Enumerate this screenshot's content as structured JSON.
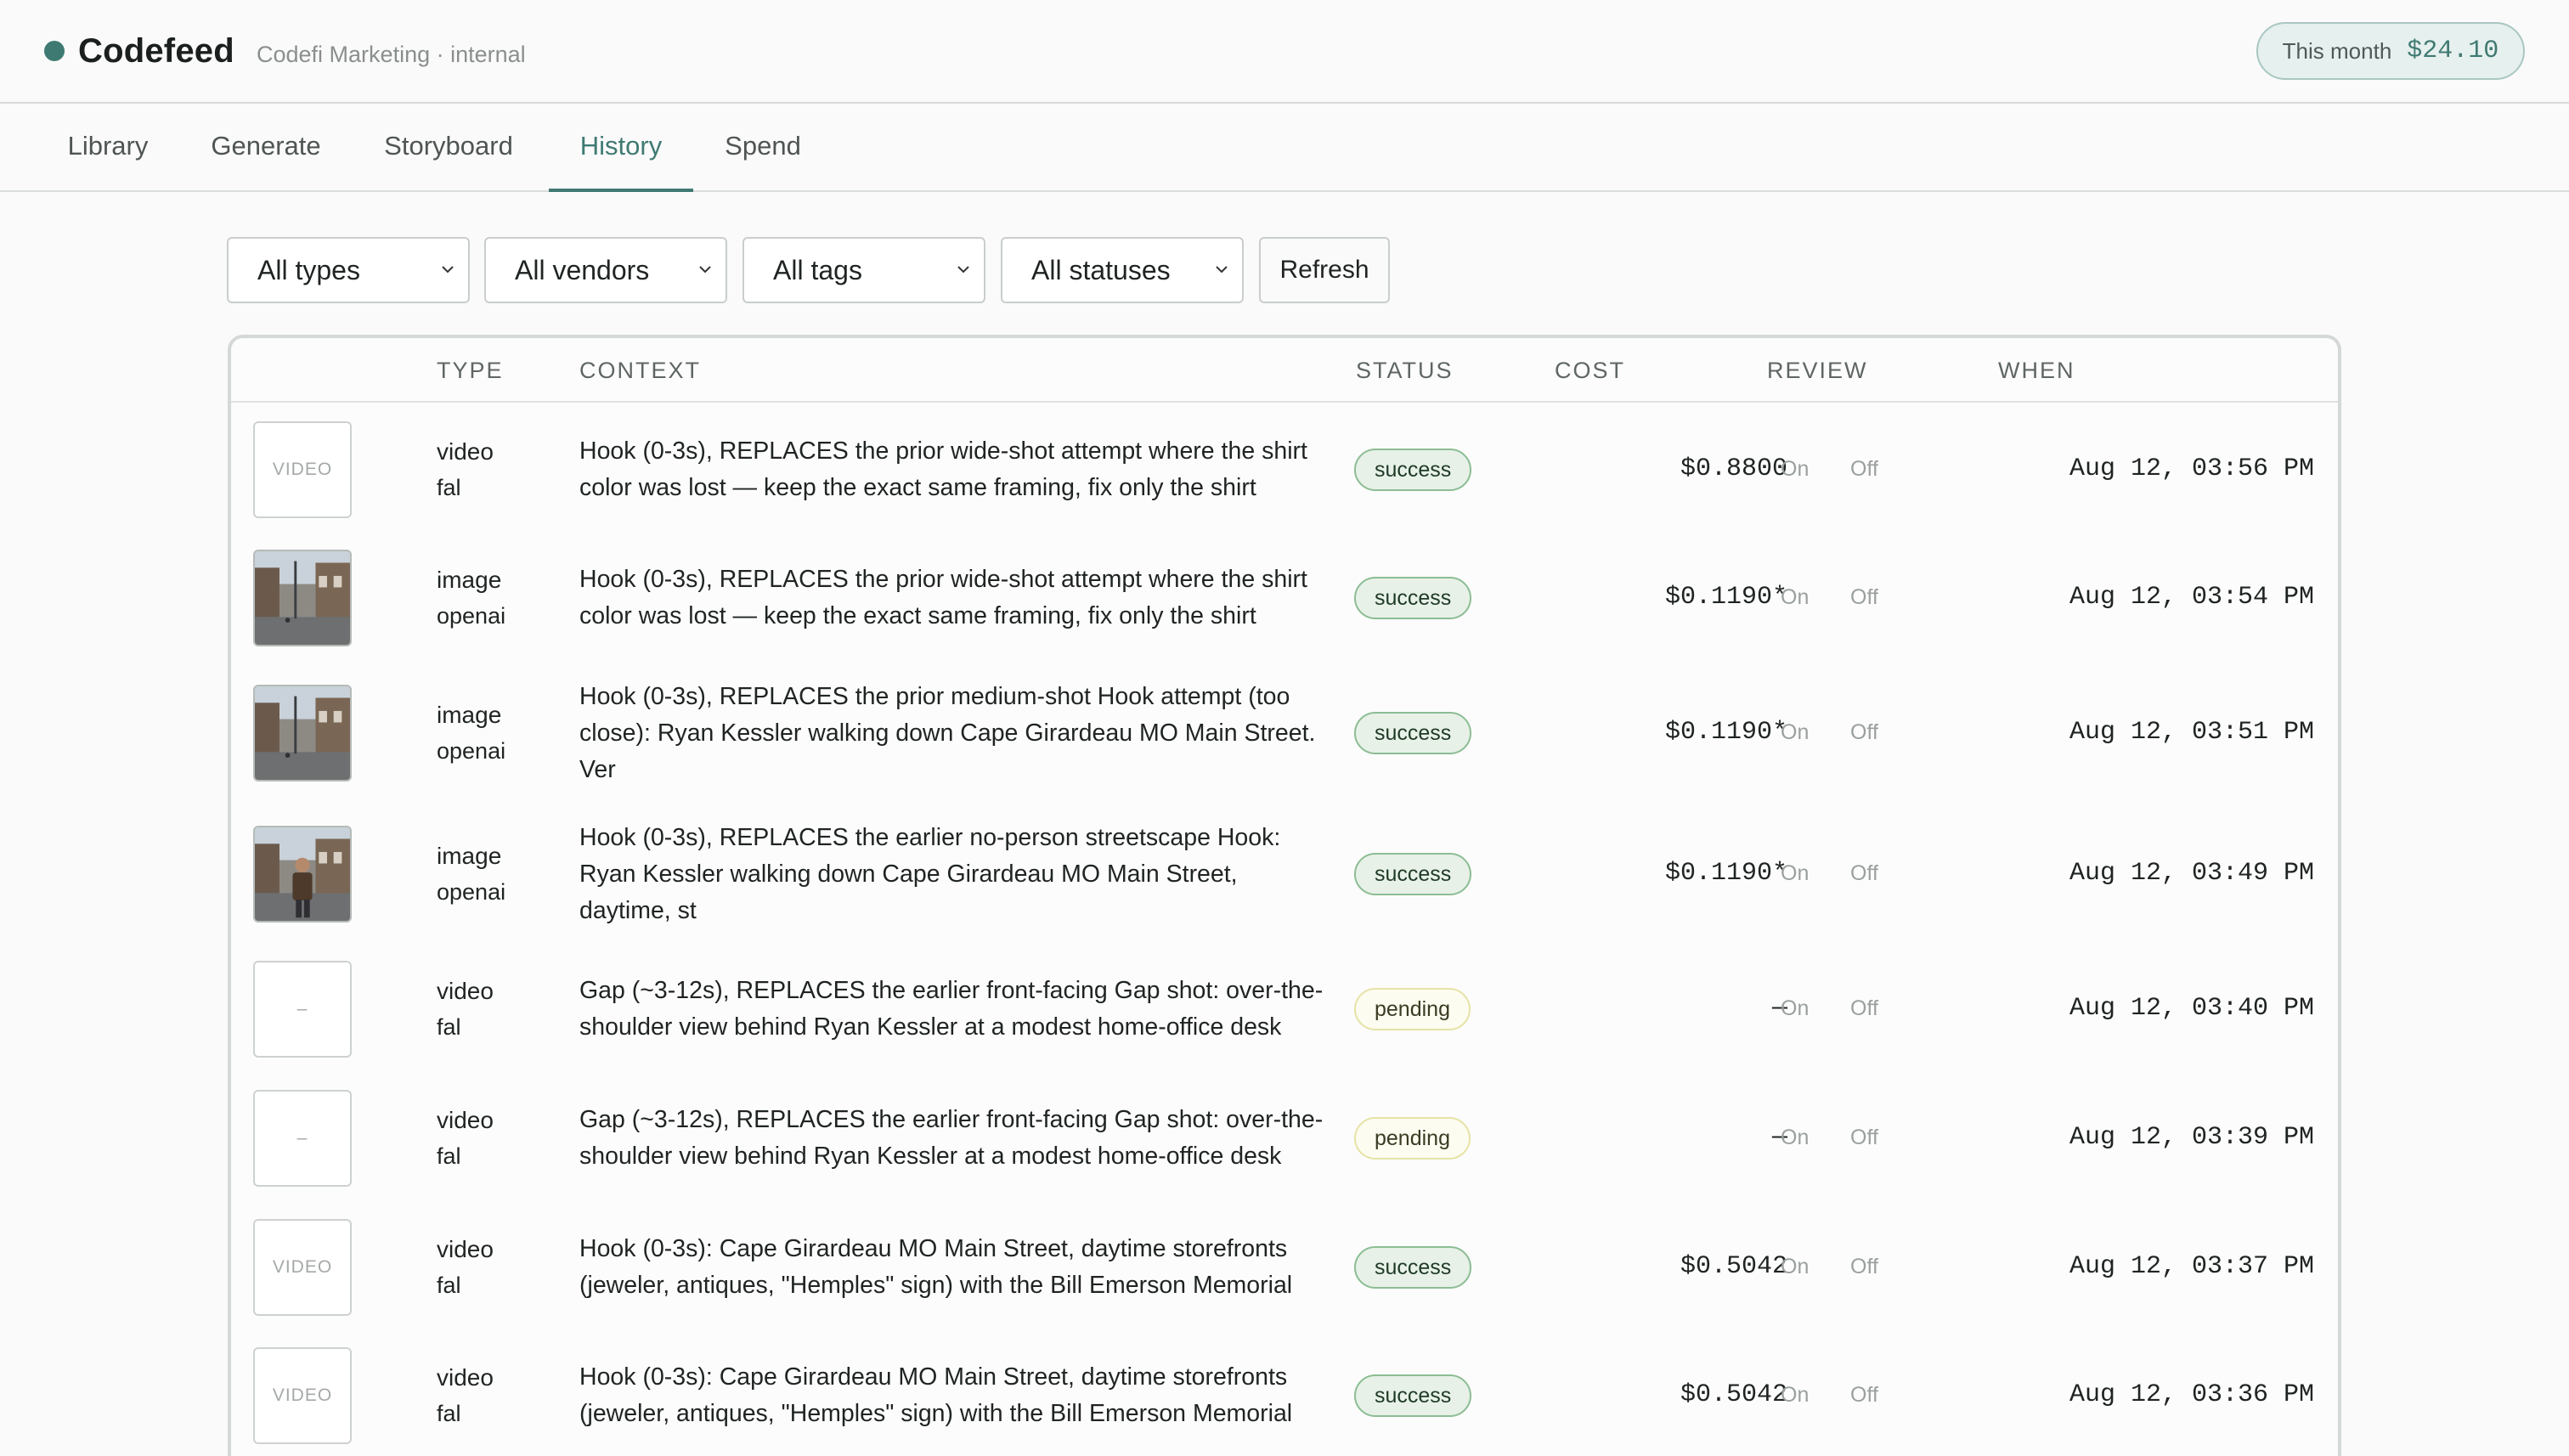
{
  "header": {
    "app_name": "Codefeed",
    "workspace": "Codefi Marketing · internal",
    "month_label": "This month",
    "month_value": "$24.10"
  },
  "tabs": [
    {
      "label": "Library",
      "active": false
    },
    {
      "label": "Generate",
      "active": false
    },
    {
      "label": "Storyboard",
      "active": false
    },
    {
      "label": "History",
      "active": true
    },
    {
      "label": "Spend",
      "active": false
    }
  ],
  "filters": {
    "types": "All types",
    "vendors": "All vendors",
    "tags": "All tags",
    "statuses": "All statuses",
    "refresh_label": "Refresh"
  },
  "table": {
    "columns": [
      "TYPE",
      "CONTEXT",
      "STATUS",
      "COST",
      "REVIEW",
      "WHEN"
    ],
    "review_on": "On",
    "review_off": "Off",
    "rows": [
      {
        "thumb": "VIDEO",
        "thumb_kind": "placeholder",
        "type": "video",
        "vendor": "fal",
        "context": "Hook (0-3s), REPLACES the prior wide-shot attempt where the shirt color was lost — keep the exact same framing, fix only the shirt",
        "status": "success",
        "cost": "$0.8800",
        "when": "Aug 12, 03:56 PM"
      },
      {
        "thumb": "",
        "thumb_kind": "street-photo",
        "type": "image",
        "vendor": "openai",
        "context": "Hook (0-3s), REPLACES the prior wide-shot attempt where the shirt color was lost — keep the exact same framing, fix only the shirt",
        "status": "success",
        "cost": "$0.1190*",
        "when": "Aug 12, 03:54 PM"
      },
      {
        "thumb": "",
        "thumb_kind": "street-photo",
        "type": "image",
        "vendor": "openai",
        "context": "Hook (0-3s), REPLACES the prior medium-shot Hook attempt (too close): Ryan Kessler walking down Cape Girardeau MO Main Street. Ver",
        "status": "success",
        "cost": "$0.1190*",
        "when": "Aug 12, 03:51 PM"
      },
      {
        "thumb": "",
        "thumb_kind": "person-photo",
        "type": "image",
        "vendor": "openai",
        "context": "Hook (0-3s), REPLACES the earlier no-person streetscape Hook: Ryan Kessler walking down Cape Girardeau MO Main Street, daytime, st",
        "status": "success",
        "cost": "$0.1190*",
        "when": "Aug 12, 03:49 PM"
      },
      {
        "thumb": "–",
        "thumb_kind": "placeholder",
        "type": "video",
        "vendor": "fal",
        "context": "Gap (~3-12s), REPLACES the earlier front-facing Gap shot: over-the-shoulder view behind Ryan Kessler at a modest home-office desk",
        "status": "pending",
        "cost": "—",
        "when": "Aug 12, 03:40 PM"
      },
      {
        "thumb": "–",
        "thumb_kind": "placeholder",
        "type": "video",
        "vendor": "fal",
        "context": "Gap (~3-12s), REPLACES the earlier front-facing Gap shot: over-the-shoulder view behind Ryan Kessler at a modest home-office desk",
        "status": "pending",
        "cost": "—",
        "when": "Aug 12, 03:39 PM"
      },
      {
        "thumb": "VIDEO",
        "thumb_kind": "placeholder",
        "type": "video",
        "vendor": "fal",
        "context": "Hook (0-3s): Cape Girardeau MO Main Street, daytime storefronts (jeweler, antiques, \"Hemples\" sign) with the Bill Emerson Memorial",
        "status": "success",
        "cost": "$0.5042",
        "when": "Aug 12, 03:37 PM"
      },
      {
        "thumb": "VIDEO",
        "thumb_kind": "placeholder",
        "type": "video",
        "vendor": "fal",
        "context": "Hook (0-3s): Cape Girardeau MO Main Street, daytime storefronts (jeweler, antiques, \"Hemples\" sign) with the Bill Emerson Memorial",
        "status": "success",
        "cost": "$0.5042",
        "when": "Aug 12, 03:36 PM"
      }
    ]
  },
  "colors": {
    "accent": "#3f7a72",
    "success_bg": "#e7f1e8",
    "pending_bg": "#fcfcf0"
  }
}
